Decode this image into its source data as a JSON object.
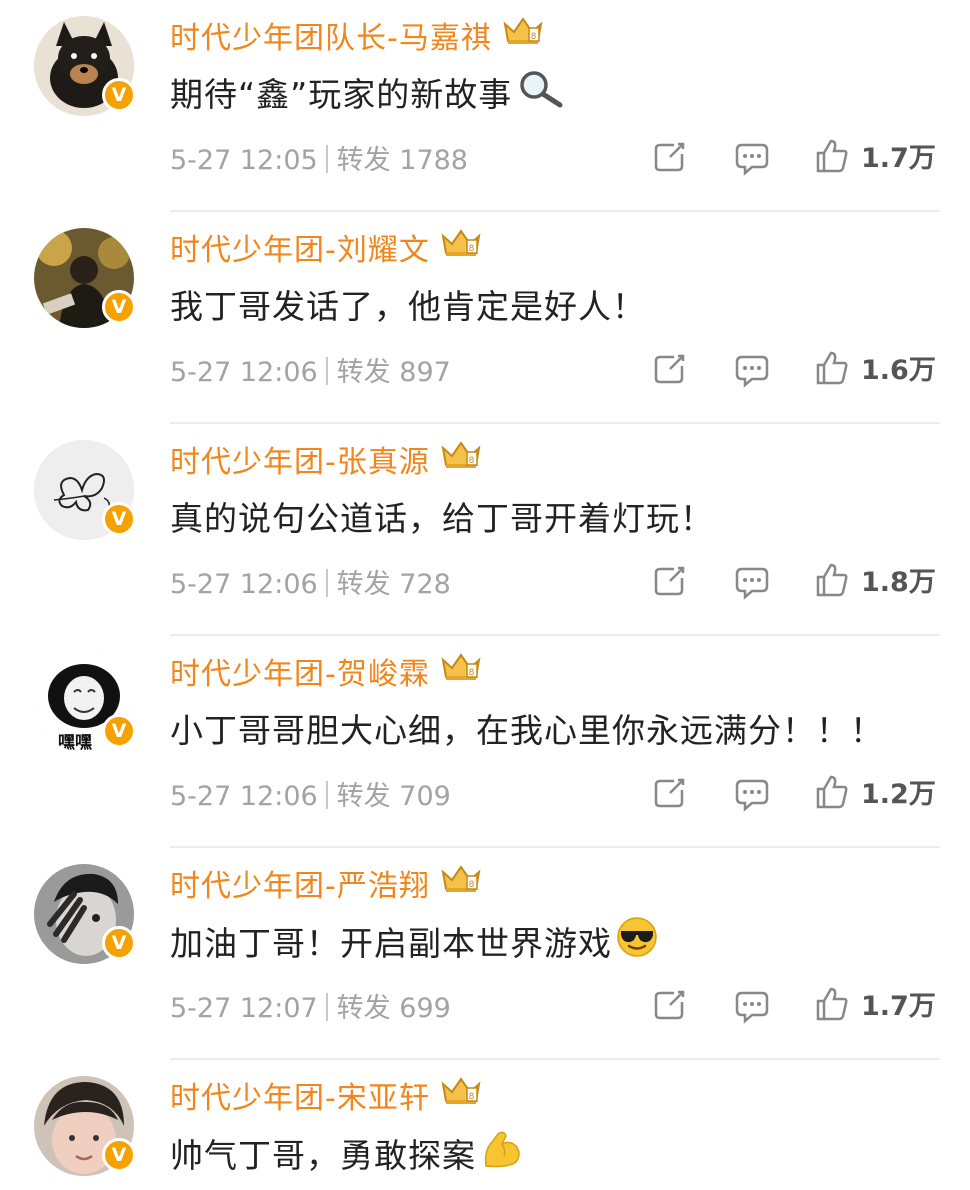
{
  "posts": [
    {
      "username": "时代少年团队长-马嘉祺",
      "content": "期待“鑫”玩家的新故事",
      "emoji": "magnifier-icon",
      "time": "5-27 12:05",
      "repost_label": "转发",
      "reposts": "1788",
      "likes": "1.7万"
    },
    {
      "username": "时代少年团-刘耀文",
      "content": "我丁哥发话了，他肯定是好人！",
      "emoji": "",
      "time": "5-27 12:06",
      "repost_label": "转发",
      "reposts": "897",
      "likes": "1.6万"
    },
    {
      "username": "时代少年团-张真源",
      "content": "真的说句公道话，给丁哥开着灯玩！",
      "emoji": "",
      "time": "5-27 12:06",
      "repost_label": "转发",
      "reposts": "728",
      "likes": "1.8万"
    },
    {
      "username": "时代少年团-贺峻霖",
      "content": "小丁哥哥胆大心细，在我心里你永远满分！！！",
      "emoji": "",
      "time": "5-27 12:06",
      "repost_label": "转发",
      "reposts": "709",
      "likes": "1.2万",
      "avatar_text": "嘿嘿"
    },
    {
      "username": "时代少年团-严浩翔",
      "content": "加油丁哥！开启副本世界游戏",
      "emoji": "sunglasses-emoji",
      "time": "5-27 12:07",
      "repost_label": "转发",
      "reposts": "699",
      "likes": "1.7万"
    },
    {
      "username": "时代少年团-宋亚轩",
      "content": "帅气丁哥，勇敢探案",
      "emoji": "flexed-biceps-emoji",
      "time": "",
      "repost_label": "",
      "reposts": "",
      "likes": ""
    }
  ],
  "verified_badge": "V",
  "colors": {
    "username": "#f0861c",
    "badge": "#f5a100",
    "meta": "#a3a3a3"
  }
}
